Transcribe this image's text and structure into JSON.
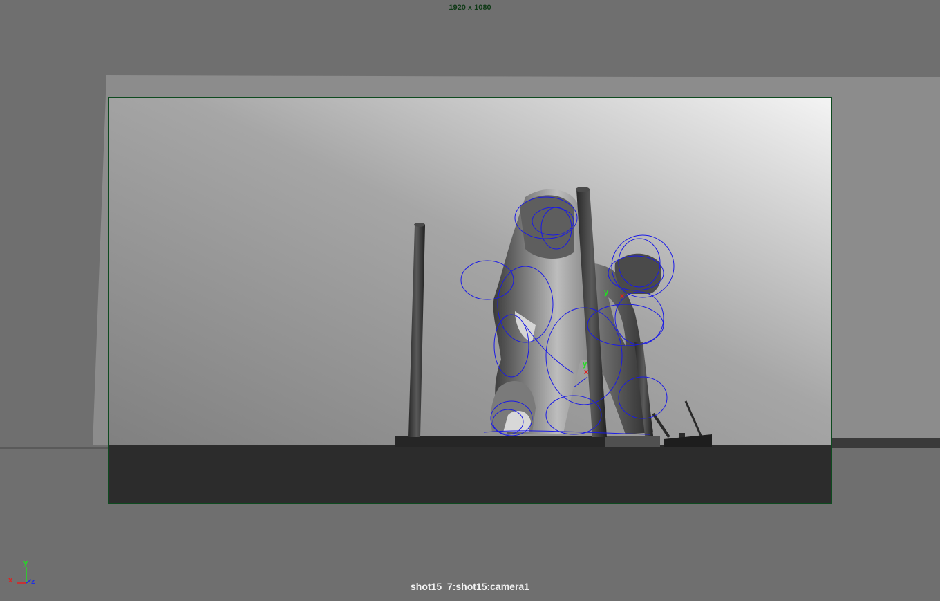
{
  "viewport": {
    "resolution_label": "1920 x 1080",
    "camera_label": "shot15_7:shot15:camera1"
  },
  "axis_gizmo": {
    "x_label": "x",
    "y_label": "y",
    "z_label": "z"
  },
  "manipulators": [
    {
      "y_label": "y",
      "x_label": "x"
    },
    {
      "y_label": "y",
      "x_label": "x"
    }
  ],
  "colors": {
    "background": "#6e6e6e",
    "resolution_gate": "#0e4a1f",
    "rig_controls": "#1a1ae6",
    "axis_x": "#e02020",
    "axis_y": "#20e020",
    "axis_z": "#2030e0"
  },
  "icons": [
    "axis-gizmo-icon"
  ]
}
